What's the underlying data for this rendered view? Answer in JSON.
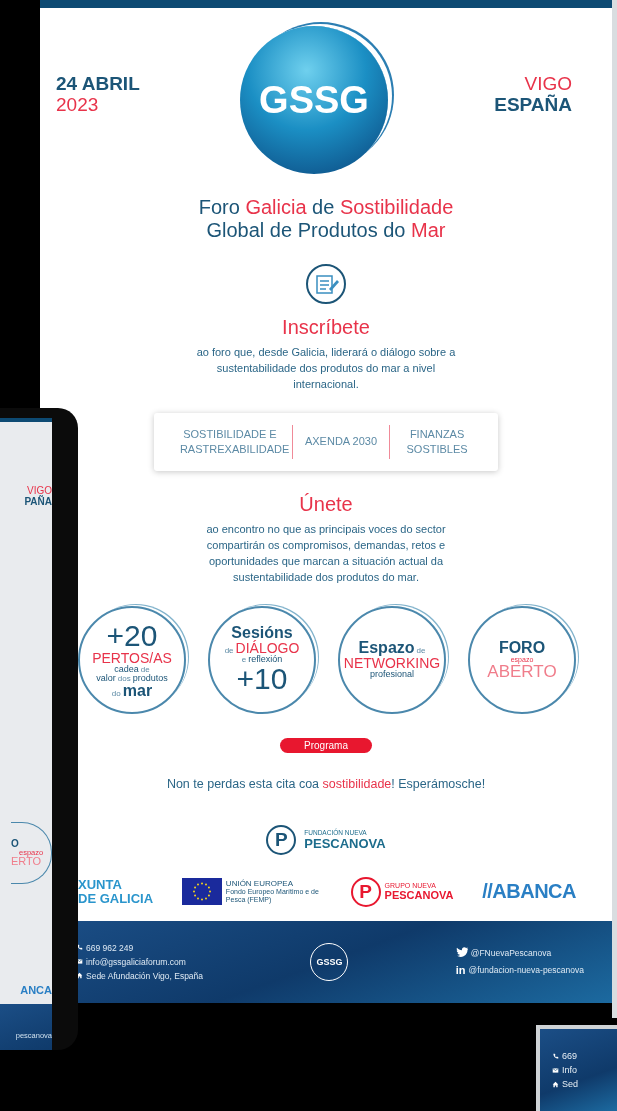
{
  "header": {
    "date": "24 ABRIL",
    "year": "2023",
    "logo": "GSSG",
    "city": "VIGO",
    "country": "ESPAÑA"
  },
  "title": [
    [
      {
        "text": "Foro ",
        "accent": false
      },
      {
        "text": "Galicia",
        "accent": true
      },
      {
        "text": " de ",
        "accent": false
      },
      {
        "text": "Sostibilidade",
        "accent": true
      }
    ],
    [
      {
        "text": "Global de Produtos do ",
        "accent": false
      },
      {
        "text": "Mar",
        "accent": true
      }
    ]
  ],
  "signup": {
    "heading": "Inscríbete",
    "text": "ao foro que, desde Galicia, liderará o diálogo sobre a sustentabilidade dos produtos do mar a nivel internacional."
  },
  "topics": [
    "SOSTIBILIDADE E RASTREXABILIDADE",
    "AXENDA 2030",
    "FINANZAS SOSTIBLES"
  ],
  "join": {
    "heading": "Únete",
    "text": "ao encontro no que as principais voces do sector compartirán os compromisos, demandas, retos e oportunidades  que marcan a situación actual da sustentabilidade dos produtos do mar."
  },
  "circles": [
    {
      "lines": [
        [
          {
            "text": "+20",
            "kind": "huge"
          }
        ],
        [
          {
            "text": "PERTOS/AS",
            "kind": "red"
          }
        ],
        [
          {
            "text": "cadea",
            "kind": "small"
          },
          {
            "text": "de",
            "kind": "tiny"
          }
        ],
        [
          {
            "text": "valor",
            "kind": "small"
          },
          {
            "text": "dos",
            "kind": "tiny"
          },
          {
            "text": "produtos",
            "kind": "small"
          }
        ],
        [
          {
            "text": "do",
            "kind": "tiny"
          },
          {
            "text": "mar",
            "kind": "title"
          }
        ]
      ]
    },
    {
      "lines": [
        [
          {
            "text": "Sesións",
            "kind": "title"
          }
        ],
        [
          {
            "text": "de",
            "kind": "tiny"
          },
          {
            "text": "DIÁLOGO",
            "kind": "red"
          }
        ],
        [
          {
            "text": "e",
            "kind": "tiny"
          },
          {
            "text": "reflexión",
            "kind": "small"
          }
        ],
        [
          {
            "text": "+10",
            "kind": "huge"
          }
        ]
      ]
    },
    {
      "lines": [
        [
          {
            "text": "Espazo",
            "kind": "title"
          },
          {
            "text": "de",
            "kind": "tiny"
          }
        ],
        [
          {
            "text": "NETWORKING",
            "kind": "red"
          }
        ],
        [
          {
            "text": "profesional",
            "kind": "small"
          }
        ]
      ]
    },
    {
      "lines": [
        [
          {
            "text": "FORO",
            "kind": "title"
          }
        ],
        [
          {
            "text": "espazo",
            "kind": "tinyred"
          }
        ],
        [
          {
            "text": "ABERTO",
            "kind": "redthin"
          }
        ]
      ]
    }
  ],
  "program_button": "Programa",
  "closing": [
    {
      "text": "Non te perdas esta cita coa ",
      "accent": false
    },
    {
      "text": "sostibilidade",
      "accent": true
    },
    {
      "text": "! Esperámosche!",
      "accent": false
    }
  ],
  "main_sponsor": {
    "mark": "P",
    "line1": "FUNDACIÓN NUEVA",
    "line2": "PESCANOVA"
  },
  "sponsors": [
    {
      "kind": "xunta",
      "line1": "XUNTA",
      "line2": "DE GALICIA"
    },
    {
      "kind": "eu",
      "line1": "UNIÓN EUROPEA",
      "line2": "Fondo Europeo Marítimo e de Pesca (FEMP)"
    },
    {
      "kind": "grupo",
      "mark": "P",
      "line1": "GRUPO NUEVA",
      "line2": "PESCANOVA"
    },
    {
      "kind": "abanca",
      "line1": "//ABANCA"
    }
  ],
  "footer": {
    "contacts": [
      {
        "kind": "phone",
        "text": "669 962 249"
      },
      {
        "kind": "mail",
        "text": "info@gssgaliciaforum.com"
      },
      {
        "kind": "home",
        "text": "Sede Afundación Vigo, España"
      }
    ],
    "logo": "GSSG",
    "social": [
      {
        "kind": "twitter",
        "text": "@FNuevaPescanova"
      },
      {
        "kind": "linkedin",
        "mark": "in",
        "text": "@fundacion-nueva-pescanova"
      }
    ]
  },
  "tablet": {
    "city": "VIGO",
    "country": "PAÑA",
    "circle": [
      "O",
      "espazo",
      "ERTO"
    ],
    "sponsor": "ANCA",
    "footer": "pescanova"
  },
  "second_device": {
    "contacts": [
      {
        "kind": "phone",
        "text": "669"
      },
      {
        "kind": "mail",
        "text": "Info"
      },
      {
        "kind": "home",
        "text": "Sed"
      }
    ]
  }
}
